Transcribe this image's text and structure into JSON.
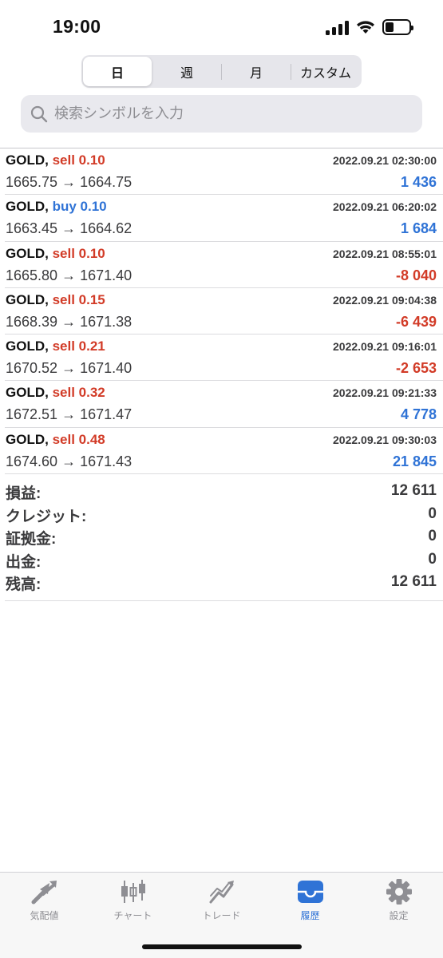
{
  "status": {
    "time": "19:00"
  },
  "segment": {
    "items": [
      "日",
      "週",
      "月",
      "カスタム"
    ],
    "active_index": 0
  },
  "search": {
    "placeholder": "検索シンボルを入力",
    "value": ""
  },
  "trades": [
    {
      "symbol": "GOLD,",
      "side": "sell",
      "volume": "0.10",
      "datetime": "2022.09.21 02:30:00",
      "prices": "1665.75 → 1664.75",
      "profit": "1 436",
      "profit_sign": "pos"
    },
    {
      "symbol": "GOLD,",
      "side": "buy",
      "volume": "0.10",
      "datetime": "2022.09.21 06:20:02",
      "prices": "1663.45 → 1664.62",
      "profit": "1 684",
      "profit_sign": "pos"
    },
    {
      "symbol": "GOLD,",
      "side": "sell",
      "volume": "0.10",
      "datetime": "2022.09.21 08:55:01",
      "prices": "1665.80 → 1671.40",
      "profit": "-8 040",
      "profit_sign": "neg"
    },
    {
      "symbol": "GOLD,",
      "side": "sell",
      "volume": "0.15",
      "datetime": "2022.09.21 09:04:38",
      "prices": "1668.39 → 1671.38",
      "profit": "-6 439",
      "profit_sign": "neg"
    },
    {
      "symbol": "GOLD,",
      "side": "sell",
      "volume": "0.21",
      "datetime": "2022.09.21 09:16:01",
      "prices": "1670.52 → 1671.40",
      "profit": "-2 653",
      "profit_sign": "neg"
    },
    {
      "symbol": "GOLD,",
      "side": "sell",
      "volume": "0.32",
      "datetime": "2022.09.21 09:21:33",
      "prices": "1672.51 → 1671.47",
      "profit": "4 778",
      "profit_sign": "pos"
    },
    {
      "symbol": "GOLD,",
      "side": "sell",
      "volume": "0.48",
      "datetime": "2022.09.21 09:30:03",
      "prices": "1674.60 → 1671.43",
      "profit": "21 845",
      "profit_sign": "pos"
    }
  ],
  "summary": [
    {
      "label": "損益:",
      "value": "12 611"
    },
    {
      "label": "クレジット:",
      "value": "0"
    },
    {
      "label": "証拠金:",
      "value": "0"
    },
    {
      "label": "出金:",
      "value": "0"
    },
    {
      "label": "残高:",
      "value": "12 611"
    }
  ],
  "tabbar": {
    "items": [
      {
        "label": "気配値",
        "icon": "quotes-arrows-icon"
      },
      {
        "label": "チャート",
        "icon": "candlestick-chart-icon"
      },
      {
        "label": "トレード",
        "icon": "trade-trend-icon"
      },
      {
        "label": "履歴",
        "icon": "history-inbox-icon"
      },
      {
        "label": "設定",
        "icon": "gear-icon"
      }
    ],
    "active_index": 3
  },
  "colors": {
    "sell": "#d23b27",
    "buy": "#2f73d6",
    "positive": "#2f73d6",
    "negative": "#d23b27",
    "tab_active": "#2f73d6",
    "tab_inactive": "#8e8e93"
  }
}
